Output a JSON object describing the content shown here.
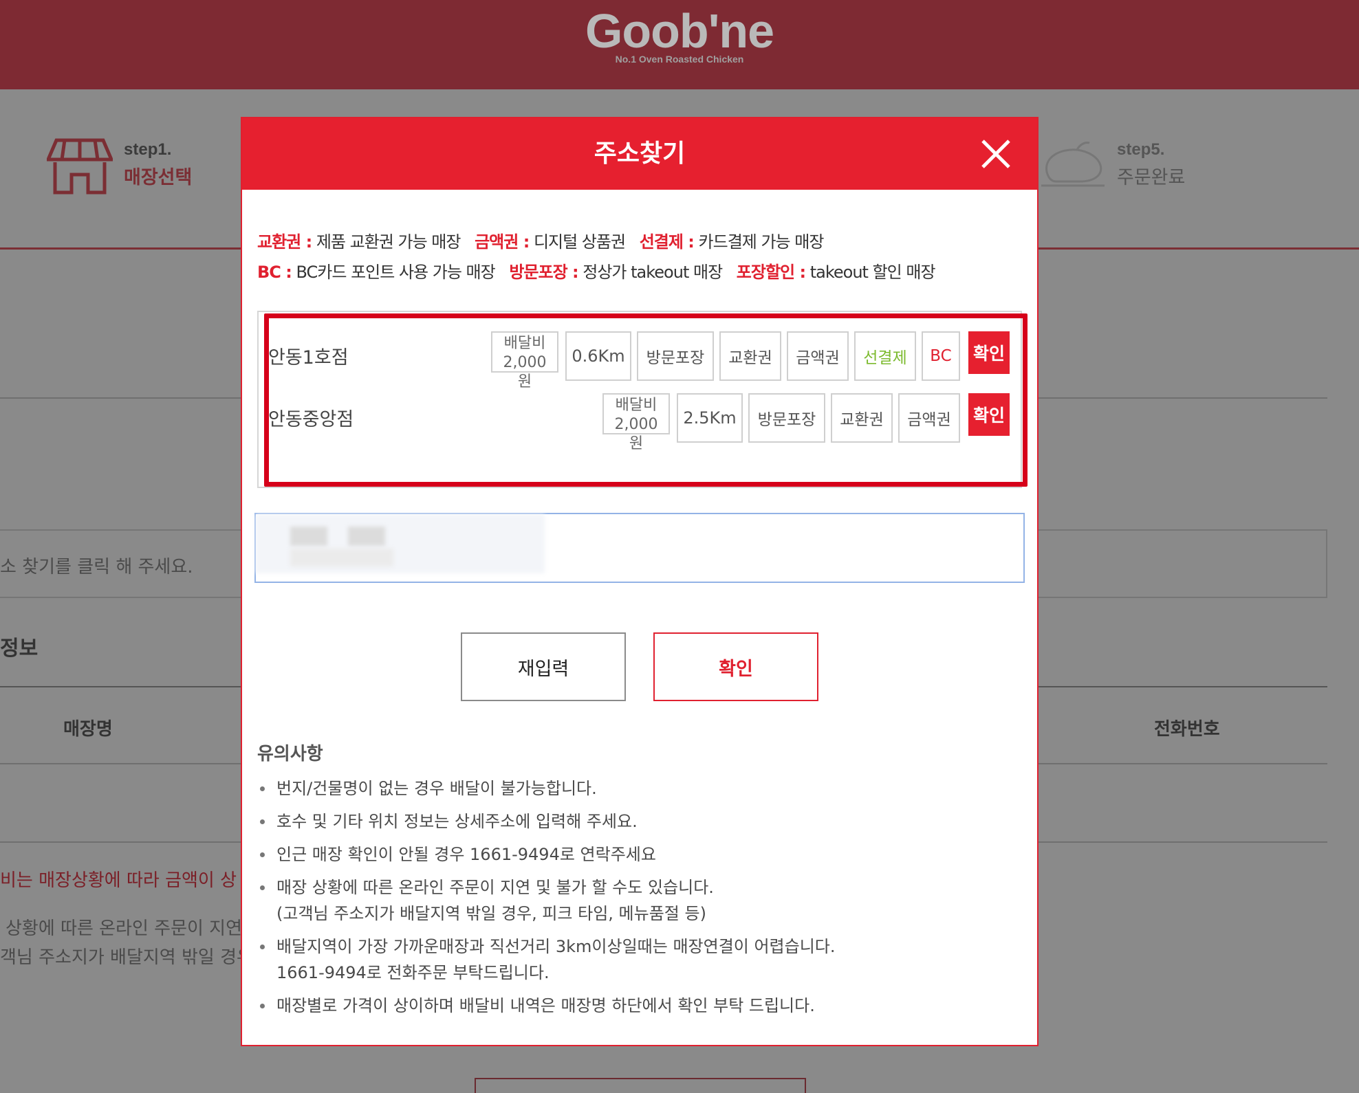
{
  "header": {
    "logo": "Goob'ne",
    "logo_sub": "No.1 Oven Roasted Chicken"
  },
  "steps": [
    {
      "num": "step1.",
      "name": "매장선택"
    },
    {
      "num": "step5.",
      "name": "주문완료"
    }
  ],
  "background": {
    "input_hint": "소 찾기를 클릭 해 주세요.",
    "section": "정보",
    "col_store": "매장명",
    "col_phone": "전화번호",
    "fee_note": "비는 매장상황에 따라 금액이 상",
    "line1": "상황에 따른 온라인 주문이 지연",
    "line2": "객님 주소지가 배달지역 밖일 경우"
  },
  "modal": {
    "title": "주소찾기",
    "legend": [
      {
        "key": "교환권 :",
        "desc": "제품 교환권 가능 매장"
      },
      {
        "key": "금액권 :",
        "desc": "디지털 상품권"
      },
      {
        "key": "선결제 :",
        "desc": "카드결제 가능 매장"
      },
      {
        "key": "BC :",
        "desc": "BC카드 포인트 사용 가능 매장"
      },
      {
        "key": "방문포장 :",
        "desc": "정상가 takeout 매장"
      },
      {
        "key": "포장할인 :",
        "desc": "takeout 할인 매장"
      }
    ],
    "stores": [
      {
        "name": "안동1호점",
        "fee_label": "배달비",
        "fee_value": "2,000",
        "fee_unit": "원",
        "distance": "0.6Km",
        "tags": [
          "방문포장",
          "교환권",
          "금액권",
          "선결제",
          "BC"
        ],
        "confirm": "확인"
      },
      {
        "name": "안동중앙점",
        "fee_label": "배달비",
        "fee_value": "2,000",
        "fee_unit": "원",
        "distance": "2.5Km",
        "tags": [
          "방문포장",
          "교환권",
          "금액권"
        ],
        "confirm": "확인"
      }
    ],
    "buttons": {
      "reset": "재입력",
      "ok": "확인"
    },
    "notes_title": "유의사항",
    "notes": [
      "번지/건물명이 없는 경우 배달이 불가능합니다.",
      "호수 및 기타 위치 정보는 상세주소에 입력해 주세요.",
      "인근 매장 확인이 안될 경우 1661-9494로 연락주세요",
      "매장 상황에 따른 온라인 주문이 지연 및 불가 할 수도 있습니다.",
      "(고객님 주소지가 배달지역 밖일 경우, 피크 타임, 메뉴품절 등)",
      "배달지역이 가장 가까운매장과 직선거리 3km이상일때는 매장연결이 어렵습니다.",
      "1661-9494로 전화주문 부탁드립니다.",
      "매장별로 가격이 상이하며 배달비 내역은 매장명 하단에서 확인 부탁 드립니다."
    ]
  },
  "colors": {
    "brand_red": "#e6202f",
    "header_dim": "#7e2a33",
    "tag_green": "#7cba2e"
  }
}
